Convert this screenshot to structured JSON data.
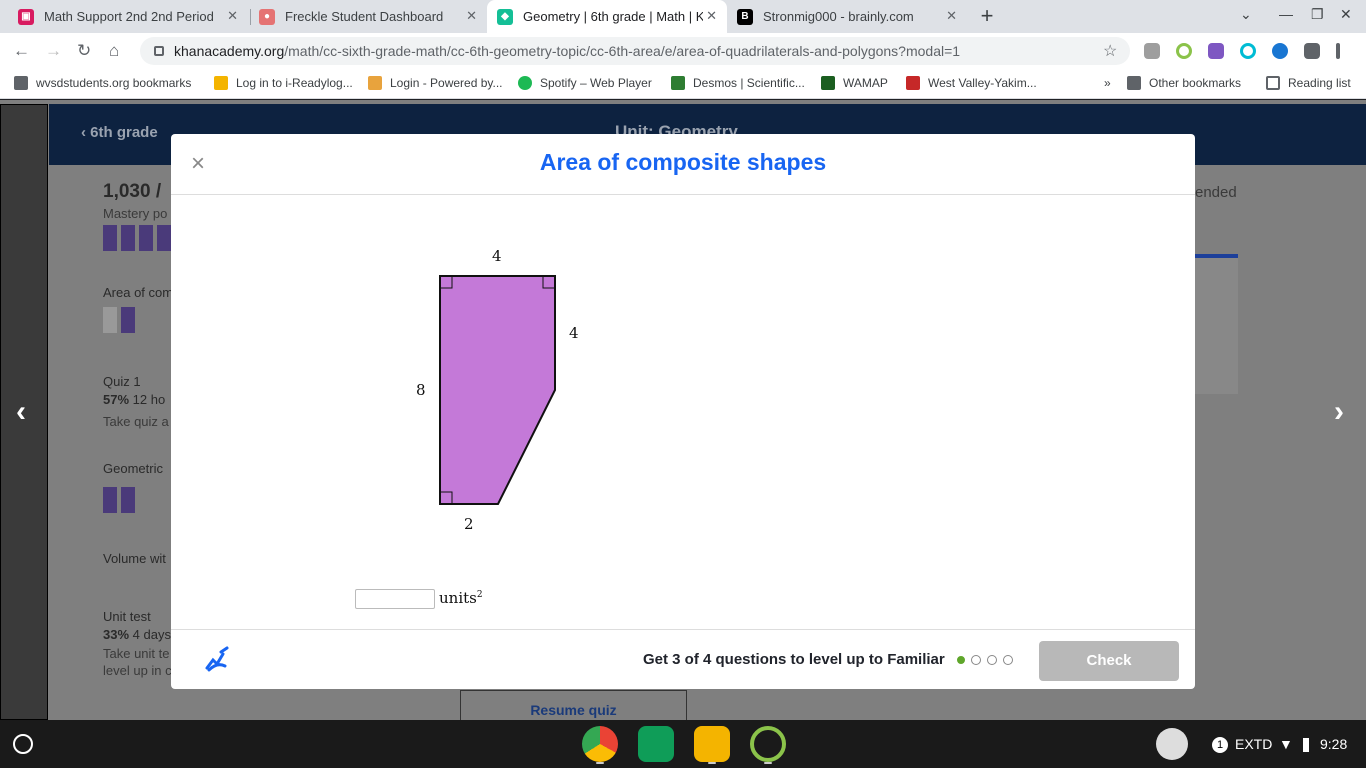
{
  "browser": {
    "tabs": [
      {
        "title": "Math Support 2nd 2nd Period",
        "color": "#d81b60",
        "active": false
      },
      {
        "title": "Freckle Student Dashboard",
        "color": "#e57373",
        "active": false
      },
      {
        "title": "Geometry | 6th grade | Math | Kh",
        "color": "#14bf96",
        "active": true
      },
      {
        "title": "Stronmig000 - brainly.com",
        "color": "#000000",
        "active": false
      }
    ],
    "new_tab": "+",
    "url_domain": "khanacademy.org",
    "url_path": "/math/cc-sixth-grade-math/cc-6th-geometry-topic/cc-6th-area/e/area-of-quadrilaterals-and-polygons?modal=1",
    "bookmarks": [
      {
        "label": "wvsdstudents.org bookmarks",
        "color": "#5f6368"
      },
      {
        "label": "Log in to i-Readylog...",
        "color": "#f4b400"
      },
      {
        "label": "Login - Powered by...",
        "color": "#e8a33d"
      },
      {
        "label": "Spotify – Web Player",
        "color": "#1db954"
      },
      {
        "label": "Desmos | Scientific...",
        "color": "#2e7d32"
      },
      {
        "label": "WAMAP",
        "color": "#1b5e20"
      },
      {
        "label": "West Valley-Yakim...",
        "color": "#c62828"
      }
    ],
    "bookmarks_more": "»",
    "other_bookmarks": "Other bookmarks",
    "reading_list": "Reading list"
  },
  "background": {
    "back_label": "6th grade",
    "unit_title": "Unit: Geometry",
    "score": "1,030 /",
    "mastery": "Mastery po",
    "items": [
      {
        "title": "Area of com"
      },
      {
        "title": "Quiz 1",
        "stat_bold": "57%",
        "stat": " 12 ho",
        "sub": "Take quiz a"
      },
      {
        "title": "Geometric"
      },
      {
        "title": "Volume wit"
      },
      {
        "title": "Unit test",
        "stat_bold": "33%",
        "stat": " 4 days",
        "sub": "Take unit te",
        "sub2": "level up in c"
      }
    ],
    "right_text": "ended",
    "resume_button": "Resume quiz"
  },
  "modal": {
    "close_icon": "×",
    "title": "Area of composite shapes",
    "figure": {
      "top_label": "4",
      "right_label": "4",
      "left_label": "8",
      "bottom_label": "2",
      "fill_color": "#c479d8"
    },
    "answer_value": "",
    "units_text": "units",
    "units_exp": "2",
    "progress_text": "Get 3 of 4 questions to level up to Familiar",
    "progress_dots": [
      true,
      false,
      false,
      false
    ],
    "check_label": "Check"
  },
  "taskbar": {
    "notification_count": "1",
    "display_label": "EXTD",
    "time": "9:28"
  }
}
